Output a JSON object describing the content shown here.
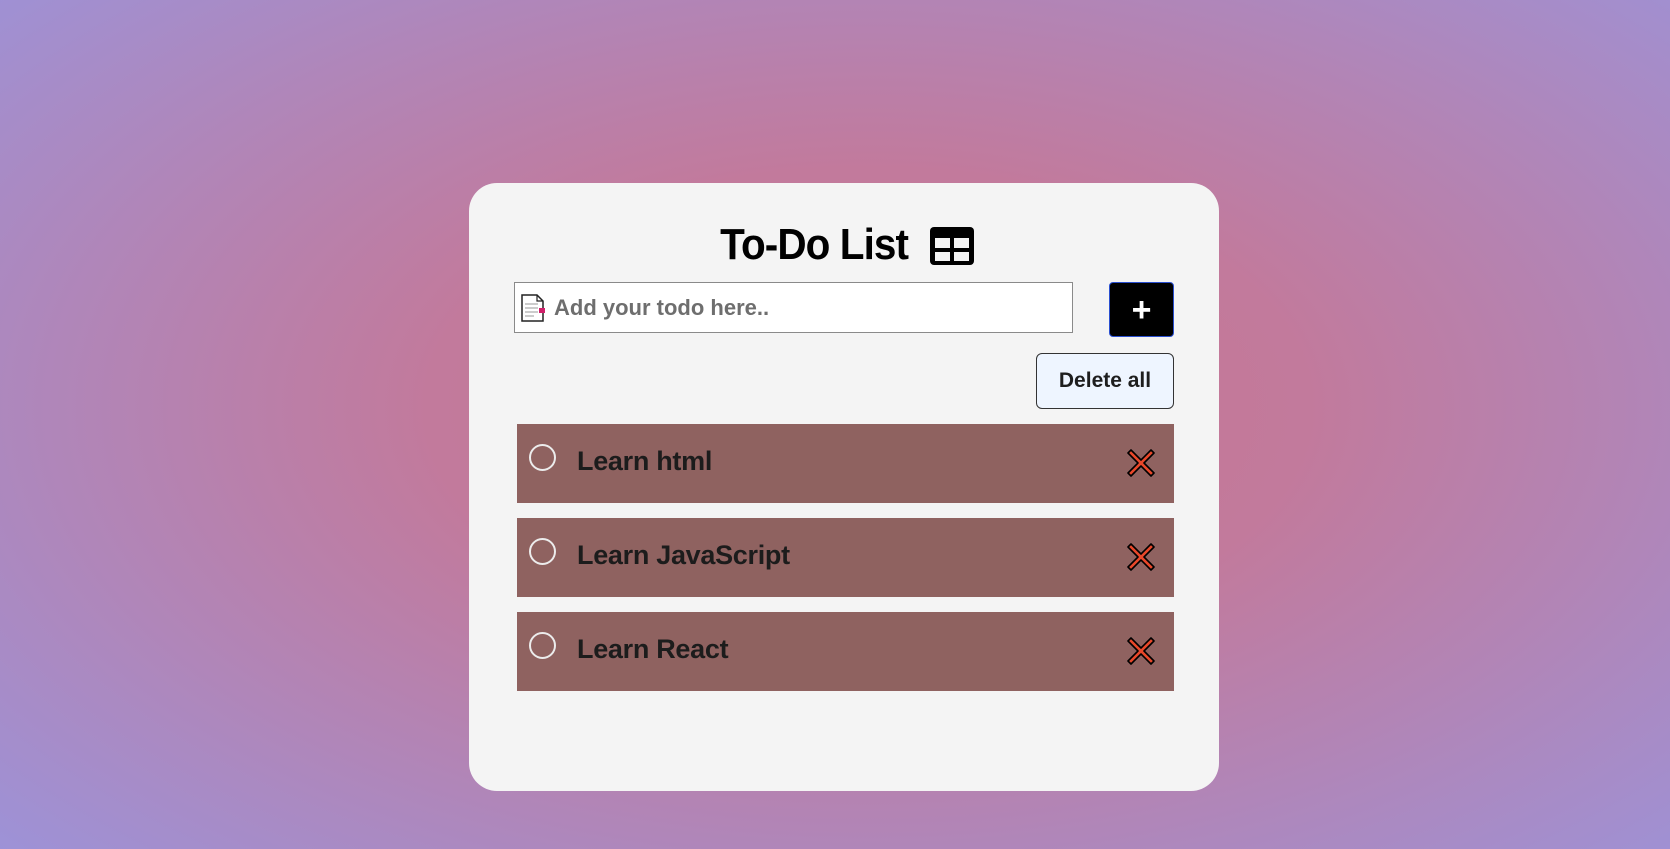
{
  "header": {
    "title": "To-Do List",
    "title_icon": "table-icon"
  },
  "input": {
    "icon": "memo-icon",
    "value": "",
    "placeholder": "Add your todo here.."
  },
  "add_button": {
    "label": "+"
  },
  "delete_all_button": {
    "label": "Delete all"
  },
  "todos": [
    {
      "text": "Learn html",
      "completed": false,
      "delete_icon": "cross-mark-icon"
    },
    {
      "text": "Learn JavaScript",
      "completed": false,
      "delete_icon": "cross-mark-icon"
    },
    {
      "text": "Learn React",
      "completed": false,
      "delete_icon": "cross-mark-icon"
    }
  ],
  "colors": {
    "card_background": "#f4f4f4",
    "todo_item_background": "#8f6260",
    "add_button_background": "#000000",
    "delete_all_background": "#eef5ff",
    "delete_icon_color": "#e8472a"
  }
}
